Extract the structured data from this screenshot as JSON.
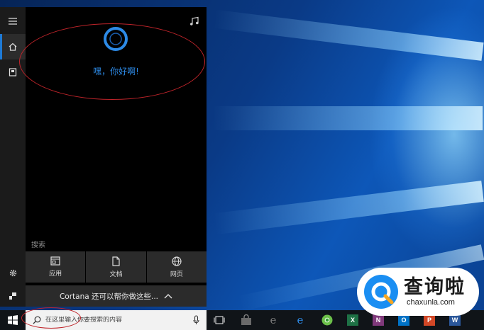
{
  "cortana": {
    "greeting": "嘿，你好啊!",
    "search_label": "搜索",
    "categories": [
      {
        "label": "应用",
        "icon": "app-icon"
      },
      {
        "label": "文档",
        "icon": "document-icon"
      },
      {
        "label": "网页",
        "icon": "globe-icon"
      }
    ],
    "more_text": "Cortana 还可以帮你做这些...",
    "notebook_icon": "music-note-icon"
  },
  "rail": {
    "items": [
      "hamburger-menu-icon",
      "home-icon",
      "notebook-icon",
      "settings-icon",
      "feedback-icon"
    ]
  },
  "taskbar": {
    "search_placeholder": "在这里输入你要搜索的内容",
    "apps": [
      {
        "name": "task-view-icon"
      },
      {
        "name": "store-icon"
      },
      {
        "name": "edge-icon"
      },
      {
        "name": "chrome-icon"
      },
      {
        "label": "X",
        "name": "excel-icon",
        "color": "#1e7145"
      },
      {
        "label": "N",
        "name": "onenote-icon",
        "color": "#80397b"
      },
      {
        "label": "O",
        "name": "outlook-icon",
        "color": "#0072c6"
      },
      {
        "label": "P",
        "name": "powerpoint-icon",
        "color": "#d24726"
      },
      {
        "label": "W",
        "name": "word-icon",
        "color": "#2b579a"
      }
    ]
  },
  "watermark": {
    "name": "查询啦",
    "domain": "chaxunla.com"
  },
  "colors": {
    "accent": "#2d8ae6",
    "annotation": "#c0242a"
  }
}
